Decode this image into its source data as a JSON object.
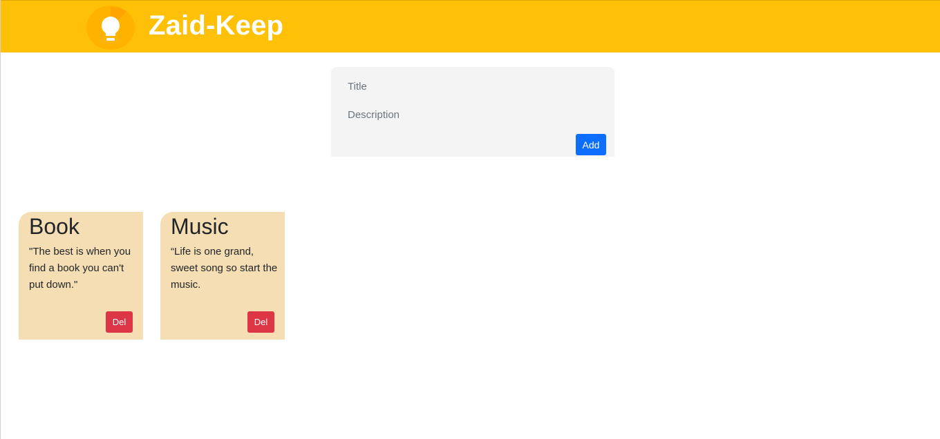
{
  "header": {
    "app_name": "Zaid-Keep",
    "logo_icon": "lightbulb-icon",
    "background_color": "#ffc107"
  },
  "compose": {
    "title_placeholder": "Title",
    "description_placeholder": "Description",
    "add_label": "Add",
    "add_color": "#0d6efd"
  },
  "notes": [
    {
      "title": "Book",
      "description": "\"The best is when you find a book you can't put down.\"",
      "delete_label": "Del"
    },
    {
      "title": "Music",
      "description": "“Life is one grand, sweet song so start the music.",
      "delete_label": "Del"
    }
  ],
  "colors": {
    "note_background": "#f5deb3",
    "delete_button": "#dc3545"
  }
}
